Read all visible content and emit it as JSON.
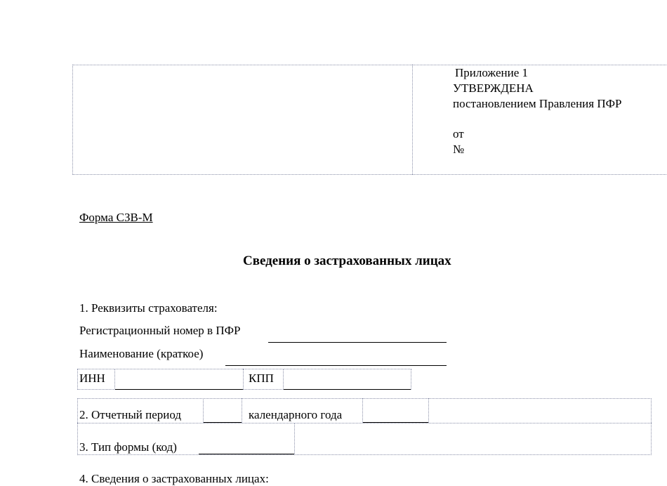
{
  "approval": {
    "appendix": "Приложение 1",
    "approved": "УТВЕРЖДЕНА",
    "resolution": "постановлением  Правления ПФР",
    "date_prefix": "от",
    "number_prefix": "№"
  },
  "form": {
    "code": "Форма СЗВ-М",
    "title": "Сведения о застрахованных лицах"
  },
  "section1": {
    "heading": "1. Реквизиты страхователя:",
    "reg_number_label": "Регистрационный  номер в ПФР",
    "name_label": "Наименование  (краткое)",
    "inn_label": "ИНН",
    "kpp_label": "КПП"
  },
  "section2": {
    "period_label": "2. Отчетный период",
    "year_label": "календарного года"
  },
  "section3": {
    "form_type_label": "3. Тип формы (код)"
  },
  "section4": {
    "heading": "4. Сведения о застрахованных лицах:"
  }
}
